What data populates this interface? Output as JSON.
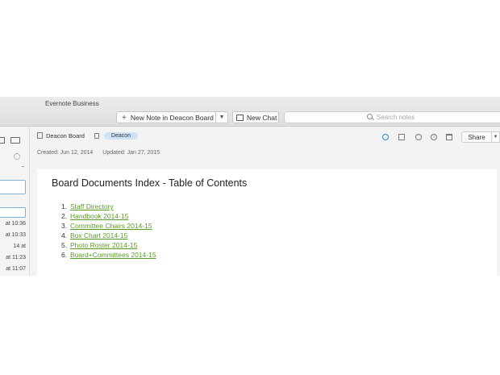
{
  "app": {
    "title": "Evernote Business"
  },
  "toolbar": {
    "new_note_label": "New Note in Deacon Board",
    "new_note_icon": "plus-icon",
    "new_chat_label": "New Chat",
    "search_placeholder": "Search notes"
  },
  "sidebar": {
    "times": [
      "at 10:36",
      "at 10:33",
      "14 at",
      "at 11:23",
      "at 11:07"
    ]
  },
  "note_header": {
    "notebook": "Deacon Board",
    "tag": "Deacon",
    "created": "Created: Jun 12, 2014",
    "updated": "Updated: Jan 27, 2015",
    "share_label": "Share"
  },
  "note": {
    "title": "Board Documents Index - Table of Contents",
    "items": [
      {
        "num": "1.",
        "label": "Staff Directory"
      },
      {
        "num": "2.",
        "label": "Handbook 2014-15"
      },
      {
        "num": "3.",
        "label": "Committee Chairs 2014-15"
      },
      {
        "num": "4.",
        "label": "Box Chart 2014-15"
      },
      {
        "num": "5.",
        "label": "Photo Roster 2014-15"
      },
      {
        "num": "6.",
        "label": "Board+Committees 2014-15"
      }
    ]
  },
  "colors": {
    "link": "#5a9a28",
    "tag_bg": "#cfe3f5",
    "focus": "#7fb3d8",
    "reminder": "#2f86c9"
  }
}
